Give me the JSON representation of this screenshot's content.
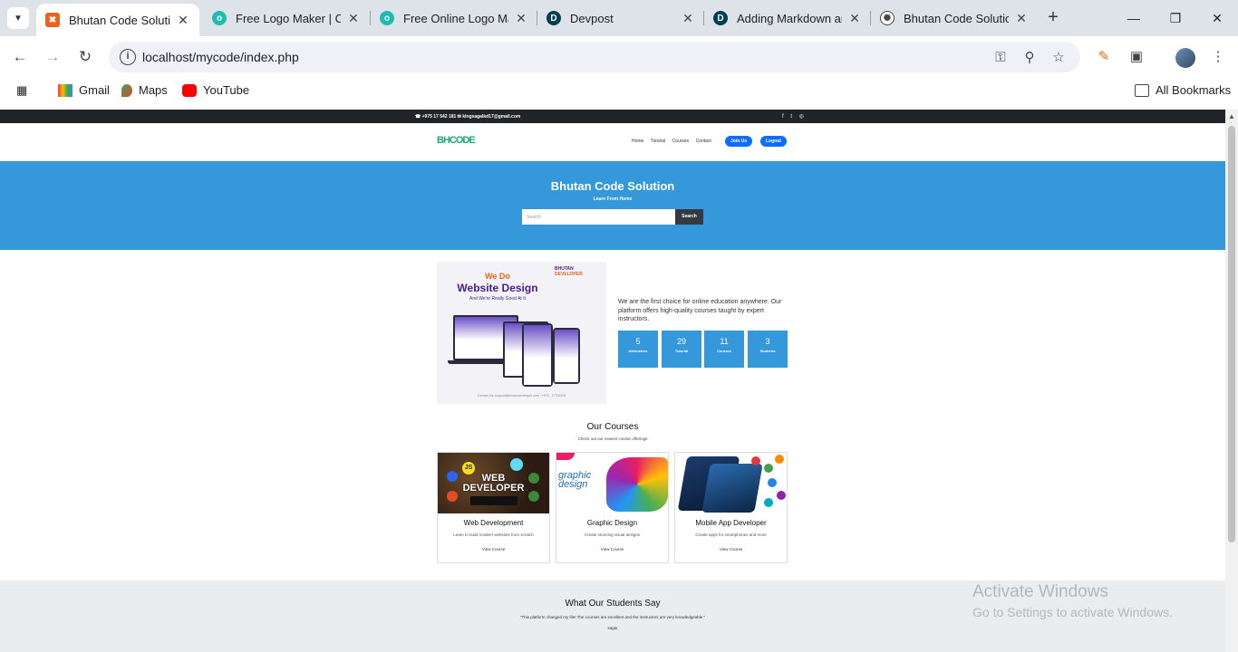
{
  "browser": {
    "tabs": [
      {
        "title": "Bhutan Code Solution",
        "favicon": "xampp-icon",
        "color": "#e8641d",
        "active": true
      },
      {
        "title": "Free Logo Maker | Cr",
        "favicon": "logo-maker-icon",
        "color": "#1fbcb0",
        "active": false
      },
      {
        "title": "Free Online Logo Ma",
        "favicon": "logo-maker-icon",
        "color": "#1fbcb0",
        "active": false
      },
      {
        "title": "Devpost",
        "favicon": "devpost-icon",
        "color": "#003e54",
        "active": false
      },
      {
        "title": "Adding Markdown ar",
        "favicon": "devpost-icon",
        "color": "#003e54",
        "active": false
      },
      {
        "title": "Bhutan Code Solution",
        "favicon": "chatgpt-icon",
        "color": "#444444",
        "active": false
      }
    ],
    "url": "localhost/mycode/index.php",
    "bookmarks": [
      {
        "label": "Gmail",
        "icon": "gmail-icon"
      },
      {
        "label": "Maps",
        "icon": "maps-icon"
      },
      {
        "label": "YouTube",
        "icon": "youtube-icon"
      }
    ],
    "all_bookmarks": "All Bookmarks"
  },
  "site": {
    "topbar": {
      "contact": "☎ +975 17 542 181  ✉ kingsagalkd17@gmail.com",
      "social": "f t ◎"
    },
    "logo": {
      "part1": "BHCODE",
      "part2": ""
    },
    "nav": {
      "home": "Home",
      "tutorial": "Tutorial",
      "courses": "Courses",
      "contact": "Contact",
      "join": "Join Us",
      "logout": "Logout"
    },
    "hero": {
      "title": "Bhutan Code Solution",
      "tagline": "Learn From Home",
      "search_placeholder": "Search",
      "search_button": "Search"
    },
    "promo": {
      "we_do": "We Do",
      "headline": "Website Design",
      "sub": "And We're Really Good At It",
      "brand_top": "BHUTAN",
      "brand_bottom": "DEVELOPER",
      "footer": "Contact Us: support@bhutandeveloper.com / +975 - 17702003"
    },
    "about": "We are the first choice for online education anywhere. Our platform offers high-quality courses taught by expert instructors.",
    "stats": [
      {
        "value": "5",
        "label": "Instructors"
      },
      {
        "value": "29",
        "label": "Tutorial"
      },
      {
        "value": "11",
        "label": "Courses"
      },
      {
        "value": "3",
        "label": "Students"
      }
    ],
    "courses_section": {
      "heading": "Our Courses",
      "sub": "Check out our newest course offerings"
    },
    "courses": [
      {
        "title": "Web Development",
        "desc": "Learn to build modern websites from scratch",
        "link": "View Course",
        "banner": "WEB DEVELOPER",
        "badge": "JS"
      },
      {
        "title": "Graphic Design",
        "desc": "Create stunning visual designs",
        "link": "View Course",
        "banner": "graphic design",
        "badge": ""
      },
      {
        "title": "Mobile App Developer",
        "desc": "Create apps for smartphones and more",
        "link": "View Course",
        "banner": "",
        "badge": ""
      }
    ],
    "testimonials": {
      "heading": "What Our Students Say",
      "quote": "\"This platform changed my life! The courses are excellent and the instructors are very knowledgeable.\"",
      "author": "sagar"
    }
  },
  "watermark": {
    "line1": "Activate Windows",
    "line2": "Go to Settings to activate Windows."
  }
}
